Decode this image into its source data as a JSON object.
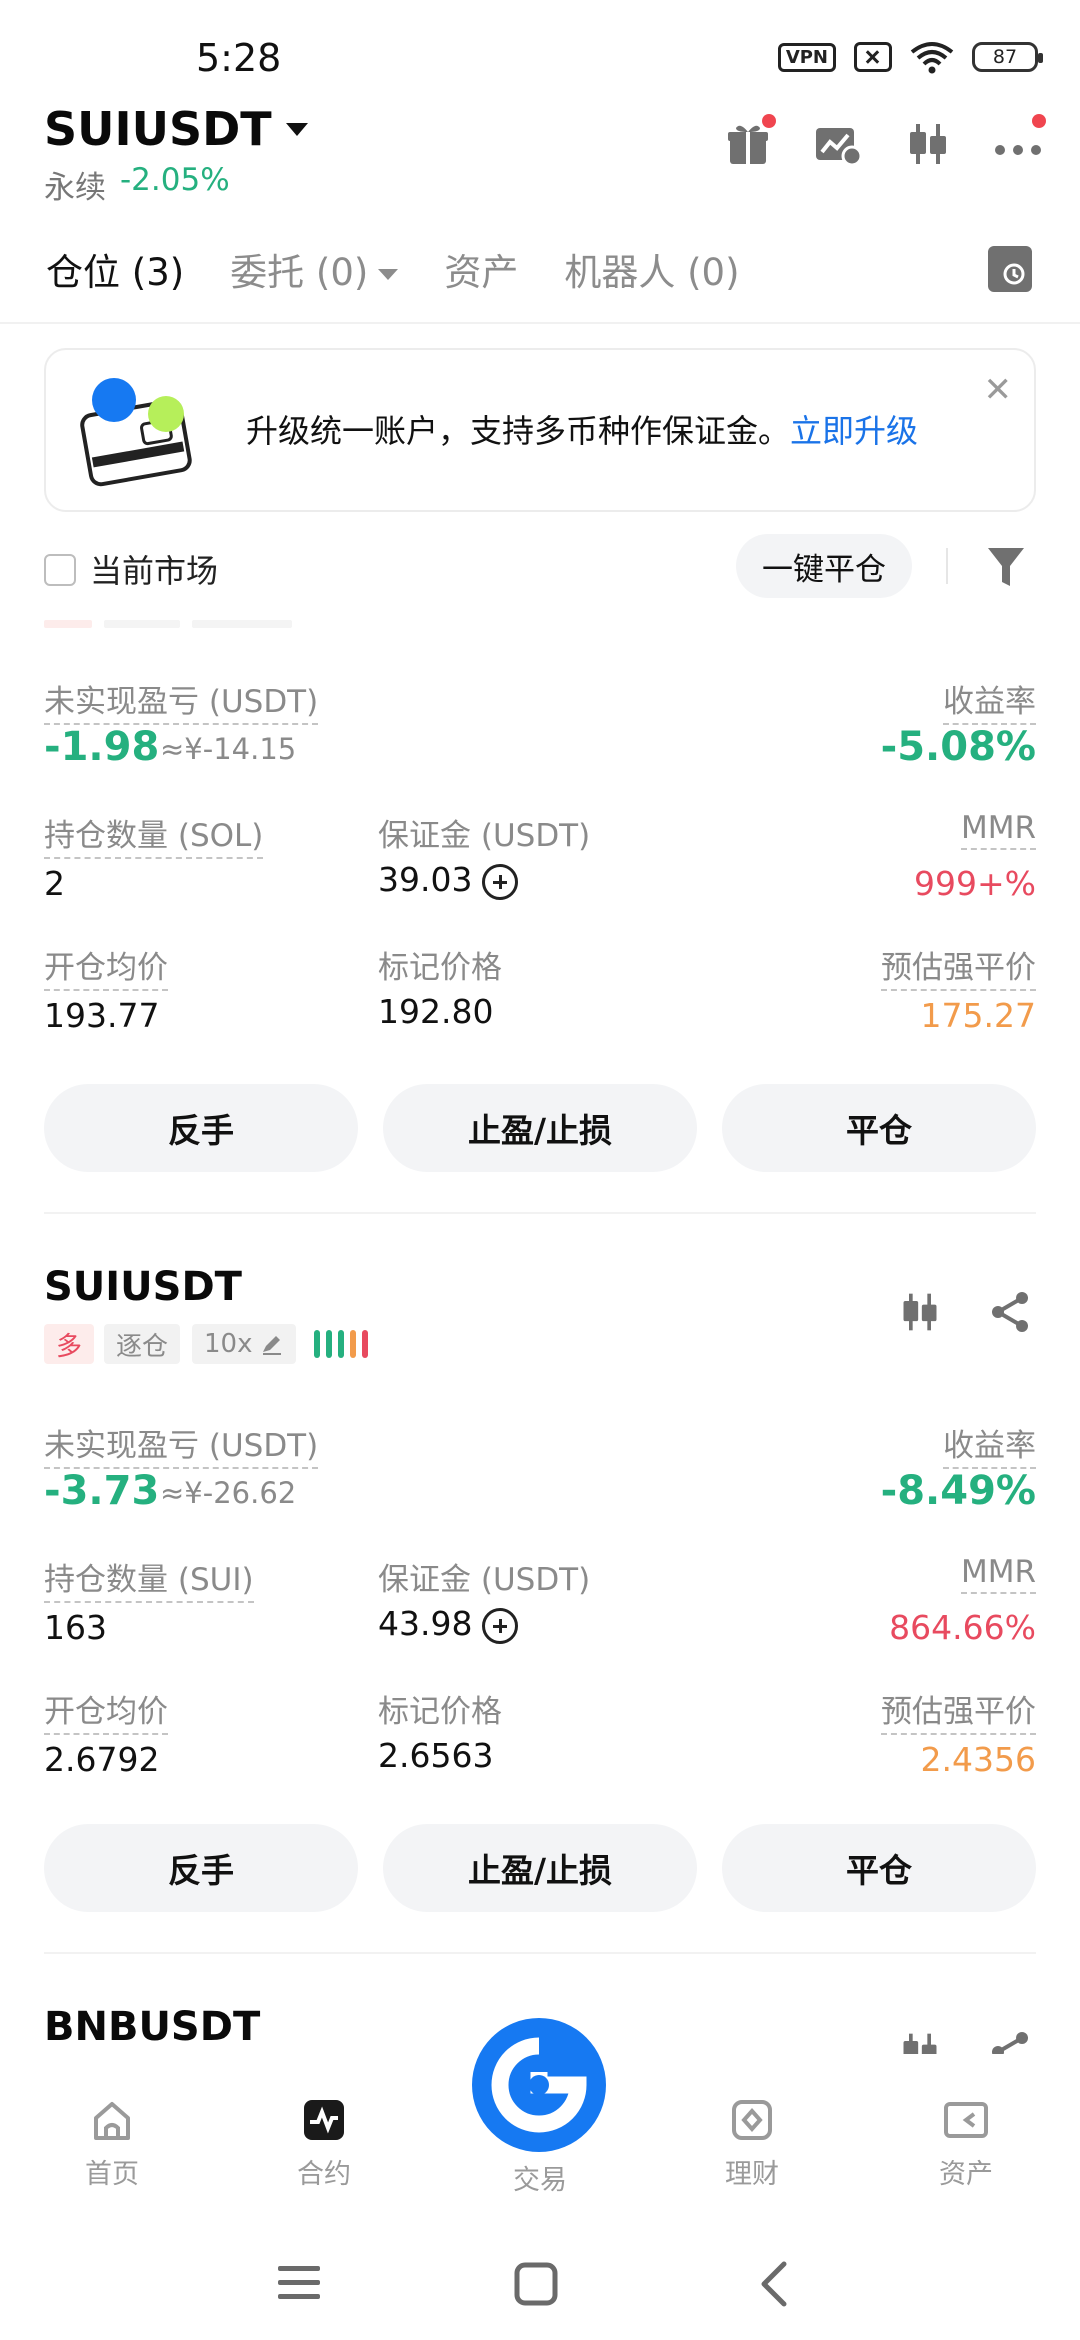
{
  "status_bar": {
    "time": "5:28",
    "vpn": "VPN",
    "battery": "87"
  },
  "header": {
    "pair": "SUIUSDT",
    "type": "永续",
    "change": "-2.05%"
  },
  "tabs": [
    {
      "label": "仓位 (3)",
      "active": true
    },
    {
      "label": "委托 (0)"
    },
    {
      "label": "资产"
    },
    {
      "label": "机器人 (0)"
    }
  ],
  "banner": {
    "text": "升级统一账户，支持多币种作保证金。",
    "link": "立即升级",
    "close": "✕"
  },
  "controls": {
    "current_market": "当前市场",
    "close_all": "一键平仓"
  },
  "labels": {
    "unrealized_pnl": "未实现盈亏 (USDT)",
    "roe": "收益率",
    "margin": "保证金 (USDT)",
    "mmr": "MMR",
    "entry_price": "开仓均价",
    "mark_price": "标记价格",
    "liq_price": "预估强平价",
    "btn_reverse": "反手",
    "btn_tpsl": "止盈/止损",
    "btn_close": "平仓"
  },
  "positions": [
    {
      "size_label": "持仓数量 (SOL)",
      "pnl": "-1.98",
      "pnl_cny": "≈¥-14.15",
      "roe": "-5.08%",
      "size": "2",
      "margin": "39.03",
      "mmr": "999+%",
      "entry": "193.77",
      "mark": "192.80",
      "liq": "175.27"
    },
    {
      "symbol": "SUIUSDT",
      "side": "多",
      "margin_mode": "逐仓",
      "leverage": "10x",
      "size_label": "持仓数量 (SUI)",
      "pnl": "-3.73",
      "pnl_cny": "≈¥-26.62",
      "roe": "-8.49%",
      "size": "163",
      "margin": "43.98",
      "mmr": "864.66%",
      "entry": "2.6792",
      "mark": "2.6563",
      "liq": "2.4356"
    },
    {
      "symbol": "BNBUSDT"
    }
  ],
  "bottom_nav": [
    {
      "label": "首页",
      "icon": "home-icon"
    },
    {
      "label": "合约",
      "icon": "futures-icon"
    },
    {
      "label": "交易",
      "icon": "trade-icon"
    },
    {
      "label": "理财",
      "icon": "earn-icon"
    },
    {
      "label": "资产",
      "icon": "wallet-icon"
    }
  ],
  "colors": {
    "green": "#25b07f",
    "red": "#e84a5f",
    "orange": "#f29b4b",
    "blue": "#1679f2"
  }
}
